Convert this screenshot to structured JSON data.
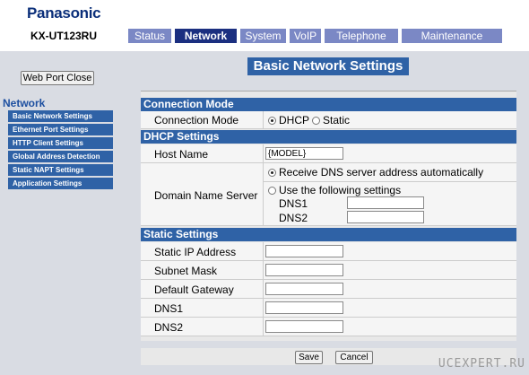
{
  "header": {
    "brand": "Panasonic",
    "model": "KX-UT123RU"
  },
  "tabs": [
    {
      "label": "Status",
      "active": false
    },
    {
      "label": "Network",
      "active": true
    },
    {
      "label": "System",
      "active": false
    },
    {
      "label": "VoIP",
      "active": false
    },
    {
      "label": "Telephone",
      "active": false
    },
    {
      "label": "Maintenance",
      "active": false
    }
  ],
  "sidebar": {
    "close_button": "Web Port Close",
    "section": "Network",
    "items": [
      {
        "label": "Basic Network Settings"
      },
      {
        "label": "Ethernet Port Settings"
      },
      {
        "label": "HTTP Client Settings"
      },
      {
        "label": "Global Address Detection"
      },
      {
        "label": "Static NAPT Settings"
      },
      {
        "label": "Application Settings"
      }
    ]
  },
  "main": {
    "title": "Basic Network Settings",
    "connection": {
      "header": "Connection Mode",
      "label": "Connection Mode",
      "options": [
        "DHCP",
        "Static"
      ],
      "selected": "DHCP"
    },
    "dhcp": {
      "header": "DHCP Settings",
      "host_label": "Host Name",
      "host_value": "{MODEL}",
      "dns_label": "Domain Name Server",
      "dns_auto": "Receive DNS server address automatically",
      "dns_manual": "Use the following settings",
      "dns_selected": "auto",
      "dns1_label": "DNS1",
      "dns1_value": "",
      "dns2_label": "DNS2",
      "dns2_value": ""
    },
    "static": {
      "header": "Static Settings",
      "fields": [
        {
          "label": "Static IP Address",
          "value": ""
        },
        {
          "label": "Subnet Mask",
          "value": ""
        },
        {
          "label": "Default Gateway",
          "value": ""
        },
        {
          "label": "DNS1",
          "value": ""
        },
        {
          "label": "DNS2",
          "value": ""
        }
      ]
    },
    "buttons": {
      "save": "Save",
      "cancel": "Cancel"
    }
  },
  "watermark": "UCEXPERT.RU",
  "colors": {
    "accent": "#2f62a6",
    "tab": "#7b88c5",
    "tab_active": "#1b2f80",
    "background": "#d9dce3"
  }
}
